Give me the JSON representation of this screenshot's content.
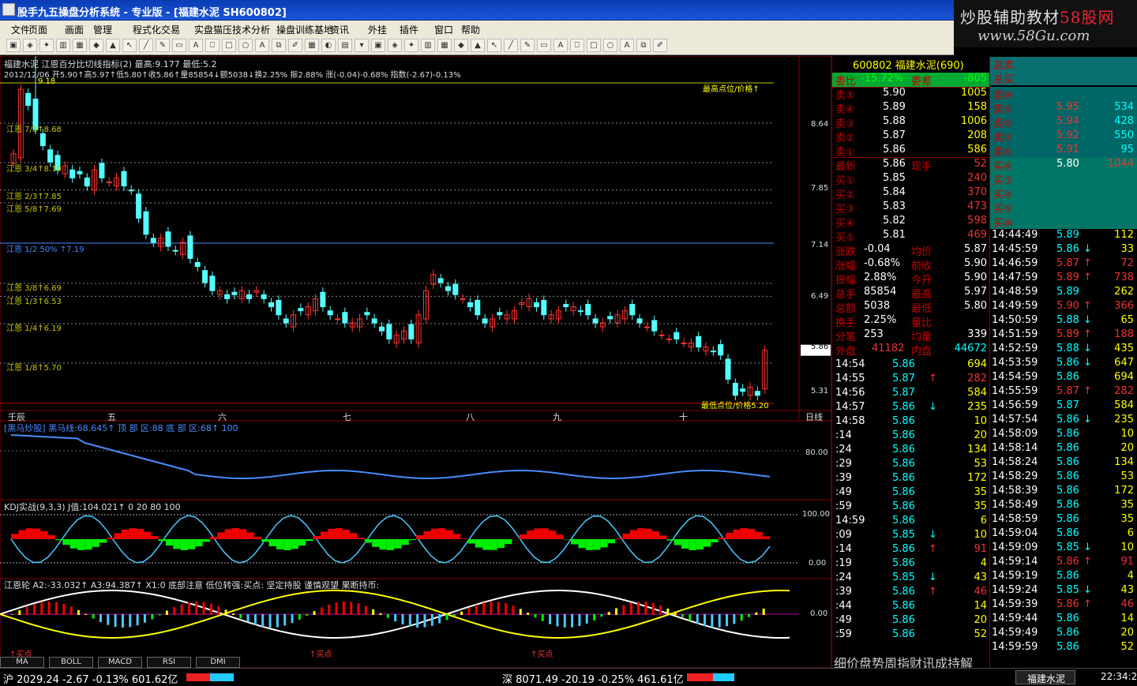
{
  "window": {
    "title": "股手九五操盘分析系统 - 专业版 - [福建水泥 SH600802]"
  },
  "watermark": {
    "line1": "炒股辅助教材",
    "line1b": "58股网",
    "line2": "www.58Gu.com"
  },
  "menu": [
    "文件",
    "页面",
    "画面",
    "管理",
    "程式化交易",
    "实盘猫压",
    "技术分析",
    "操盘训练基地",
    "资讯",
    "外挂",
    "插件",
    "窗口",
    "帮助"
  ],
  "chart": {
    "header1": "福建水泥  江恩百分比切线指标(2) 最高:9.177 最低:5.2",
    "header2": "2012/12/06 开5.90↑高5.97↑低5.80↑收5.86↑量85854↓额5038↓换2.25% 振2.88% 涨(-0.04)-0.68% 指数(-2.67)-0.13%",
    "price_axis": [
      "8.64",
      "7.85",
      "7.14",
      "6.49",
      "5.86",
      "5.31"
    ],
    "highest_label": "最高点位/价格↑",
    "lowest_label": "最低点位/价格5.20",
    "peak_label": "9.18",
    "gann_labels": [
      {
        "text": "江恩 7/8↑8.68",
        "color": "#c8c800"
      },
      {
        "text": "江恩 3/4↑8.19",
        "color": "#c8c800"
      },
      {
        "text": "江恩 2/3↑7.85",
        "color": "#c8c800"
      },
      {
        "text": "江恩 5/8↑7.69",
        "color": "#c8c800"
      },
      {
        "text": "江恩 1/2  50%   ↑7.19",
        "color": "#4a8cff"
      },
      {
        "text": "江恩 3/8↑6.69",
        "color": "#c8c800"
      },
      {
        "text": "江恩 1/3↑6.53",
        "color": "#c8c800"
      },
      {
        "text": "江恩 1/4↑6.19",
        "color": "#c8c800"
      },
      {
        "text": "江恩 1/8↑5.70",
        "color": "#c8c800"
      }
    ],
    "months": [
      "壬辰",
      "五",
      "六",
      "七",
      "八",
      "九",
      "十"
    ],
    "period": "日线",
    "ind1": {
      "name": "[黑马炒股]",
      "line": "黑马线:68.645↑",
      "top": "顶  部  区:88",
      "bottom": "底  部  区:68↑",
      "val": "100",
      "axis": "80.00"
    },
    "ind2": {
      "name": "KDJ实战(9,3,3)",
      "j": "J值:104.021↑",
      "vals": "0  20  80  100",
      "axis_top": "100.00",
      "axis_bot": "0.00"
    },
    "ind3": {
      "name": "江恩轮",
      "a2": "A2:-33.032↑",
      "a3": "A3:94.387↑",
      "x1": "X1:0",
      "t1": "底部注意",
      "t2": "低位转强:买点:",
      "t3": "坚定持股",
      "t4": "谨慎观望",
      "t5": "果断持币:",
      "axis": "0.00",
      "buy": "↑买点"
    },
    "tabs": [
      "MA",
      "BOLL",
      "MACD",
      "RSI",
      "DMI"
    ]
  },
  "quote": {
    "code": "600802 福建水泥(690)",
    "webi": "委比",
    "webi_v": "-15.72%",
    "weicha": "委差",
    "weicha_v": "-805",
    "sells": [
      {
        "l": "卖⑤",
        "p": "5.90",
        "v": "1005"
      },
      {
        "l": "卖④",
        "p": "5.89",
        "v": "158"
      },
      {
        "l": "卖③",
        "p": "5.88",
        "v": "1006"
      },
      {
        "l": "卖②",
        "p": "5.87",
        "v": "208"
      },
      {
        "l": "卖①",
        "p": "5.86",
        "v": "586"
      }
    ],
    "latest": "最新",
    "latest_v": "5.86",
    "xianshou": "现手",
    "xianshou_v": "52",
    "buys": [
      {
        "l": "买①",
        "p": "5.85",
        "v": "240"
      },
      {
        "l": "买②",
        "p": "5.84",
        "v": "370"
      },
      {
        "l": "买③",
        "p": "5.83",
        "v": "473"
      },
      {
        "l": "买④",
        "p": "5.82",
        "v": "598"
      },
      {
        "l": "买⑤",
        "p": "5.81",
        "v": "469"
      }
    ],
    "stats": [
      {
        "a": "涨跌",
        "b": "-0.04",
        "c": "均价",
        "d": "5.87"
      },
      {
        "a": "涨幅",
        "b": "-0.68%",
        "c": "前收",
        "d": "5.90"
      },
      {
        "a": "振幅",
        "b": "2.88%",
        "c": "今开",
        "d": "5.90"
      },
      {
        "a": "总手",
        "b": "85854",
        "c": "最高",
        "d": "5.97"
      },
      {
        "a": "总额",
        "b": "5038",
        "c": "最低",
        "d": "5.80"
      },
      {
        "a": "换手",
        "b": "2.25%",
        "c": "量比",
        "d": ""
      },
      {
        "a": "分笔",
        "b": "253",
        "c": "均量",
        "d": "339"
      }
    ],
    "waipan": "外盘",
    "waipan_v": "41182",
    "neipan": "内盘",
    "neipan_v": "44672",
    "ticks": [
      {
        "t": "14:54",
        "p": "5.86",
        "v": "694",
        "a": ""
      },
      {
        "t": "14:55",
        "p": "5.87",
        "v": "282",
        "a": "↑"
      },
      {
        "t": "14:56",
        "p": "5.87",
        "v": "584",
        "a": ""
      },
      {
        "t": "14:57",
        "p": "5.86",
        "v": "235",
        "a": "↓"
      },
      {
        "t": "14:58",
        "p": "5.86",
        "v": "10",
        "a": ""
      },
      {
        "t": ":14",
        "p": "5.86",
        "v": "20",
        "a": ""
      },
      {
        "t": ":24",
        "p": "5.86",
        "v": "134",
        "a": ""
      },
      {
        "t": ":29",
        "p": "5.86",
        "v": "53",
        "a": ""
      },
      {
        "t": ":39",
        "p": "5.86",
        "v": "172",
        "a": ""
      },
      {
        "t": ":49",
        "p": "5.86",
        "v": "35",
        "a": ""
      },
      {
        "t": ":59",
        "p": "5.86",
        "v": "35",
        "a": ""
      },
      {
        "t": "14:59",
        "p": "5.86",
        "v": "6",
        "a": ""
      },
      {
        "t": ":09",
        "p": "5.85",
        "v": "10",
        "a": "↓"
      },
      {
        "t": ":14",
        "p": "5.86",
        "v": "91",
        "a": "↑"
      },
      {
        "t": ":19",
        "p": "5.86",
        "v": "4",
        "a": ""
      },
      {
        "t": ":24",
        "p": "5.85",
        "v": "43",
        "a": "↓"
      },
      {
        "t": ":39",
        "p": "5.86",
        "v": "46",
        "a": "↑"
      },
      {
        "t": ":44",
        "p": "5.86",
        "v": "14",
        "a": ""
      },
      {
        "t": ":49",
        "p": "5.86",
        "v": "20",
        "a": ""
      },
      {
        "t": ":59",
        "p": "5.86",
        "v": "52",
        "a": ""
      }
    ],
    "bottom_tabs": "细价盘势周指财讯成持解"
  },
  "depth": {
    "zongmai": "总卖",
    "zongmai2": "总买",
    "levels": [
      {
        "l": "卖⑩",
        "p": "",
        "v": ""
      },
      {
        "l": "卖⑨",
        "p": "5.95",
        "v": "534"
      },
      {
        "l": "卖⑧",
        "p": "5.94",
        "v": "428"
      },
      {
        "l": "卖⑦",
        "p": "5.92",
        "v": "550"
      },
      {
        "l": "卖⑥",
        "p": "5.91",
        "v": "95"
      },
      {
        "l": "买⑥",
        "p": "5.80",
        "v": "1044"
      },
      {
        "l": "买⑦",
        "p": "",
        "v": ""
      },
      {
        "l": "买⑧",
        "p": "",
        "v": ""
      },
      {
        "l": "买⑨",
        "p": "",
        "v": ""
      },
      {
        "l": "买⑩",
        "p": "",
        "v": ""
      }
    ],
    "ticks": [
      {
        "t": "14:44:49",
        "p": "5.89",
        "v": "112",
        "a": ""
      },
      {
        "t": "14:45:59",
        "p": "5.86",
        "v": "33",
        "a": "↓"
      },
      {
        "t": "14:46:59",
        "p": "5.87",
        "v": "72",
        "a": "↑"
      },
      {
        "t": "14:47:59",
        "p": "5.89",
        "v": "738",
        "a": "↑"
      },
      {
        "t": "14:48:59",
        "p": "5.89",
        "v": "262",
        "a": ""
      },
      {
        "t": "14:49:59",
        "p": "5.90",
        "v": "366",
        "a": "↑"
      },
      {
        "t": "14:50:59",
        "p": "5.88",
        "v": "65",
        "a": "↓"
      },
      {
        "t": "14:51:59",
        "p": "5.89",
        "v": "188",
        "a": "↑"
      },
      {
        "t": "14:52:59",
        "p": "5.88",
        "v": "435",
        "a": "↓"
      },
      {
        "t": "14:53:59",
        "p": "5.86",
        "v": "647",
        "a": "↓"
      },
      {
        "t": "14:54:59",
        "p": "5.86",
        "v": "694",
        "a": ""
      },
      {
        "t": "14:55:59",
        "p": "5.87",
        "v": "282",
        "a": "↑"
      },
      {
        "t": "14:56:59",
        "p": "5.87",
        "v": "584",
        "a": ""
      },
      {
        "t": "14:57:54",
        "p": "5.86",
        "v": "235",
        "a": "↓"
      },
      {
        "t": "14:58:09",
        "p": "5.86",
        "v": "10",
        "a": ""
      },
      {
        "t": "14:58:14",
        "p": "5.86",
        "v": "20",
        "a": ""
      },
      {
        "t": "14:58:24",
        "p": "5.86",
        "v": "134",
        "a": ""
      },
      {
        "t": "14:58:29",
        "p": "5.86",
        "v": "53",
        "a": ""
      },
      {
        "t": "14:58:39",
        "p": "5.86",
        "v": "172",
        "a": ""
      },
      {
        "t": "14:58:49",
        "p": "5.86",
        "v": "35",
        "a": ""
      },
      {
        "t": "14:58:59",
        "p": "5.86",
        "v": "35",
        "a": ""
      },
      {
        "t": "14:59:04",
        "p": "5.86",
        "v": "6",
        "a": ""
      },
      {
        "t": "14:59:09",
        "p": "5.85",
        "v": "10",
        "a": "↓"
      },
      {
        "t": "14:59:14",
        "p": "5.86",
        "v": "91",
        "a": "↑"
      },
      {
        "t": "14:59:19",
        "p": "5.86",
        "v": "4",
        "a": ""
      },
      {
        "t": "14:59:24",
        "p": "5.85",
        "v": "43",
        "a": "↓"
      },
      {
        "t": "14:59:39",
        "p": "5.86",
        "v": "46",
        "a": "↑"
      },
      {
        "t": "14:59:44",
        "p": "5.86",
        "v": "14",
        "a": ""
      },
      {
        "t": "14:59:49",
        "p": "5.86",
        "v": "20",
        "a": ""
      },
      {
        "t": "14:59:59",
        "p": "5.86",
        "v": "52",
        "a": ""
      }
    ]
  },
  "status": {
    "sh": "沪 2029.24 -2.67 -0.13% 601.62亿",
    "sz": "深 8071.49 -20.19 -0.25% 461.61亿",
    "stock": "福建水泥",
    "time": "22:34:29"
  }
}
